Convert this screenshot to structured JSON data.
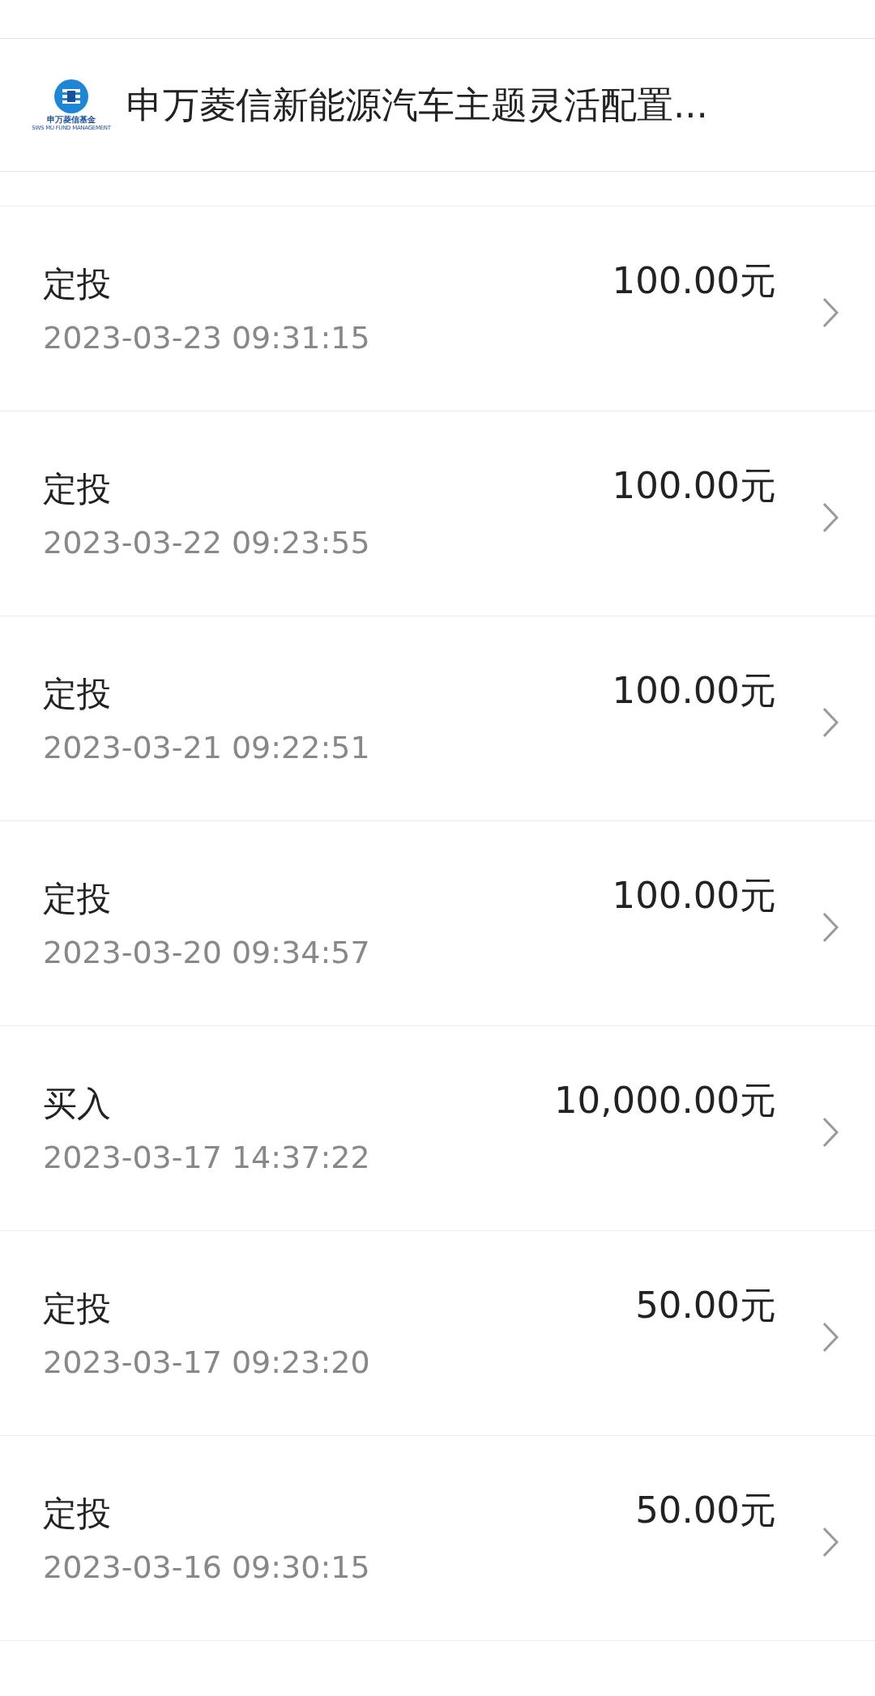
{
  "header": {
    "logo": {
      "name": "申万菱信基金",
      "subtitle": "SWS MU FUND MANAGEMENT"
    },
    "title": "申万菱信新能源汽车主题灵活配置..."
  },
  "records": [
    {
      "type": "定投",
      "time": "2023-03-23 09:31:15",
      "amount": "100.00元"
    },
    {
      "type": "定投",
      "time": "2023-03-22 09:23:55",
      "amount": "100.00元"
    },
    {
      "type": "定投",
      "time": "2023-03-21 09:22:51",
      "amount": "100.00元"
    },
    {
      "type": "定投",
      "time": "2023-03-20 09:34:57",
      "amount": "100.00元"
    },
    {
      "type": "买入",
      "time": "2023-03-17 14:37:22",
      "amount": "10,000.00元"
    },
    {
      "type": "定投",
      "time": "2023-03-17 09:23:20",
      "amount": "50.00元"
    },
    {
      "type": "定投",
      "time": "2023-03-16 09:30:15",
      "amount": "50.00元"
    }
  ]
}
